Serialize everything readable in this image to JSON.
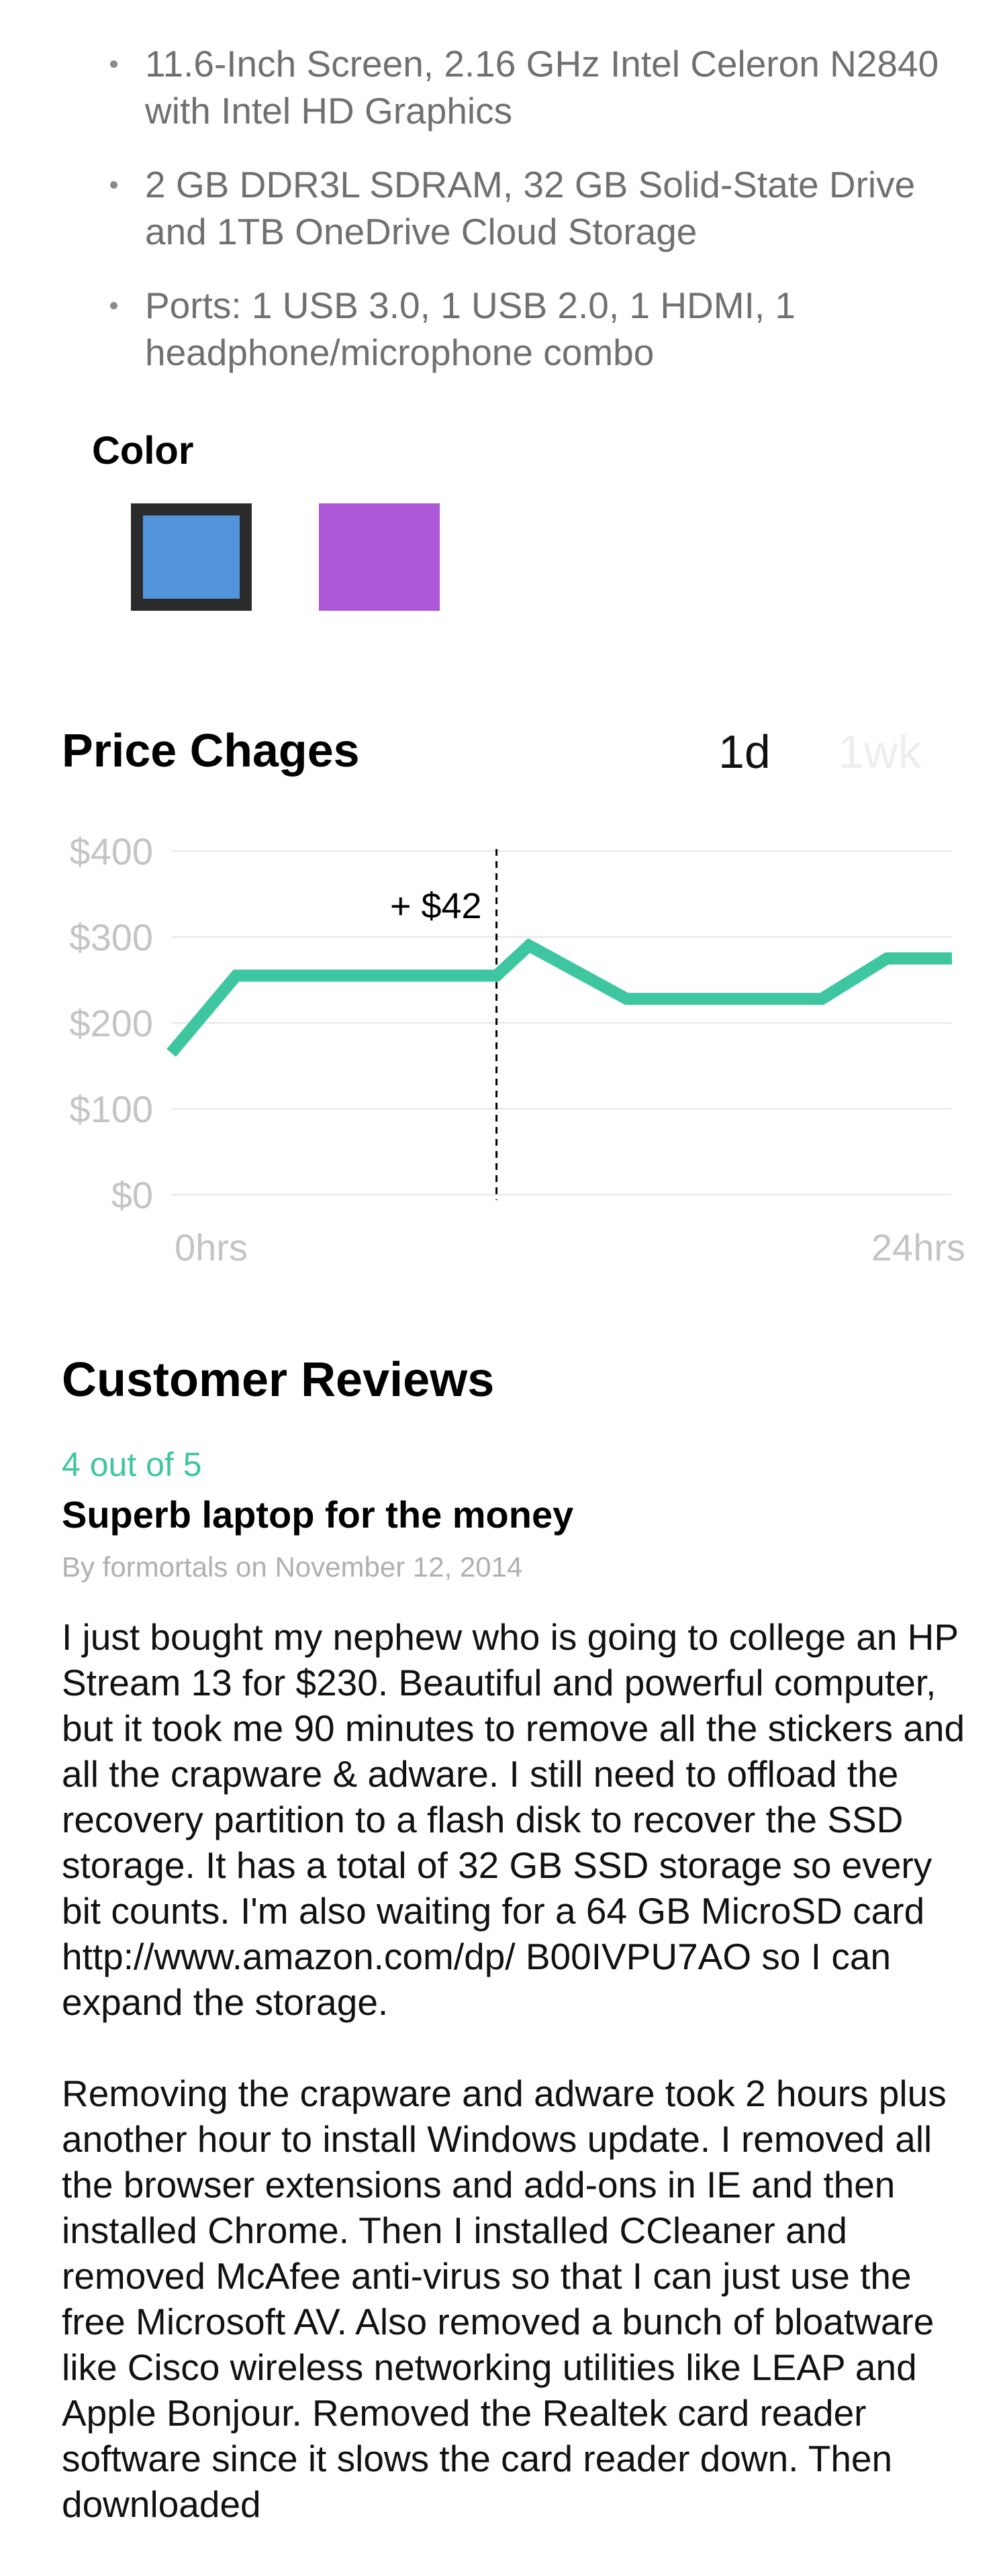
{
  "features": [
    "11.6-Inch Screen, 2.16 GHz Intel Celeron N2840 with Intel HD Graphics",
    "2 GB DDR3L SDRAM, 32 GB Solid-State Drive and 1TB OneDrive Cloud Storage",
    "Ports: 1 USB 3.0, 1 USB 2.0, 1 HDMI, 1 headphone/microphone combo"
  ],
  "color_section": {
    "heading": "Color",
    "swatches": [
      {
        "name": "blue",
        "hex": "#5294dc",
        "selected": true
      },
      {
        "name": "purple",
        "hex": "#ab57d8",
        "selected": false
      }
    ]
  },
  "price_changes": {
    "heading": "Price Chages",
    "tabs": [
      {
        "label": "1d",
        "active": true
      },
      {
        "label": "1wk",
        "active": false
      }
    ],
    "annotation": "+ $42",
    "accent_color": "#3ec6a0"
  },
  "chart_data": {
    "type": "line",
    "title": "Price Chages",
    "x": [
      0,
      2,
      4,
      6,
      8,
      10,
      11,
      14,
      17,
      20,
      22,
      24
    ],
    "y": [
      165,
      255,
      255,
      255,
      255,
      255,
      290,
      228,
      228,
      228,
      275,
      275
    ],
    "xlim": [
      0,
      24
    ],
    "ylim": [
      0,
      400
    ],
    "x_tick_labels": [
      "0hrs",
      "24hrs"
    ],
    "y_tick_labels": [
      "$400",
      "$300",
      "$200",
      "$100",
      "$0"
    ],
    "y_ticks": [
      400,
      300,
      200,
      100,
      0
    ],
    "grid": true,
    "marker_x": 10,
    "marker_label": "+ $42"
  },
  "reviews": {
    "heading": "Customer Reviews",
    "items": [
      {
        "rating": "4 out of 5",
        "title": "Superb laptop for the money",
        "byline": "By formortals on November 12, 2014",
        "paragraphs": [
          "I just bought my nephew who is going to college an HP Stream 13 for $230. Beautiful and powerful computer, but it took me 90 minutes to remove all the stickers and all the crapware & adware. I still need to offload the recovery partition to a flash disk to recover the SSD storage. It has a total of 32 GB SSD storage so every bit counts. I'm also waiting for a 64 GB MicroSD card http://www.amazon.com/dp/ B00IVPU7AO so I can expand the storage.",
          "Removing the crapware and adware took 2 hours plus another hour to install Windows update. I removed all the browser extensions and add-ons in IE and then installed Chrome. Then I installed CCleaner and removed McAfee anti-virus so that I can just use the free Microsoft AV. Also removed a bunch of bloatware like Cisco wireless networking utilities like LEAP and Apple Bonjour. Removed the Realtek card reader software since it slows the card reader down. Then downloaded"
        ]
      }
    ]
  }
}
